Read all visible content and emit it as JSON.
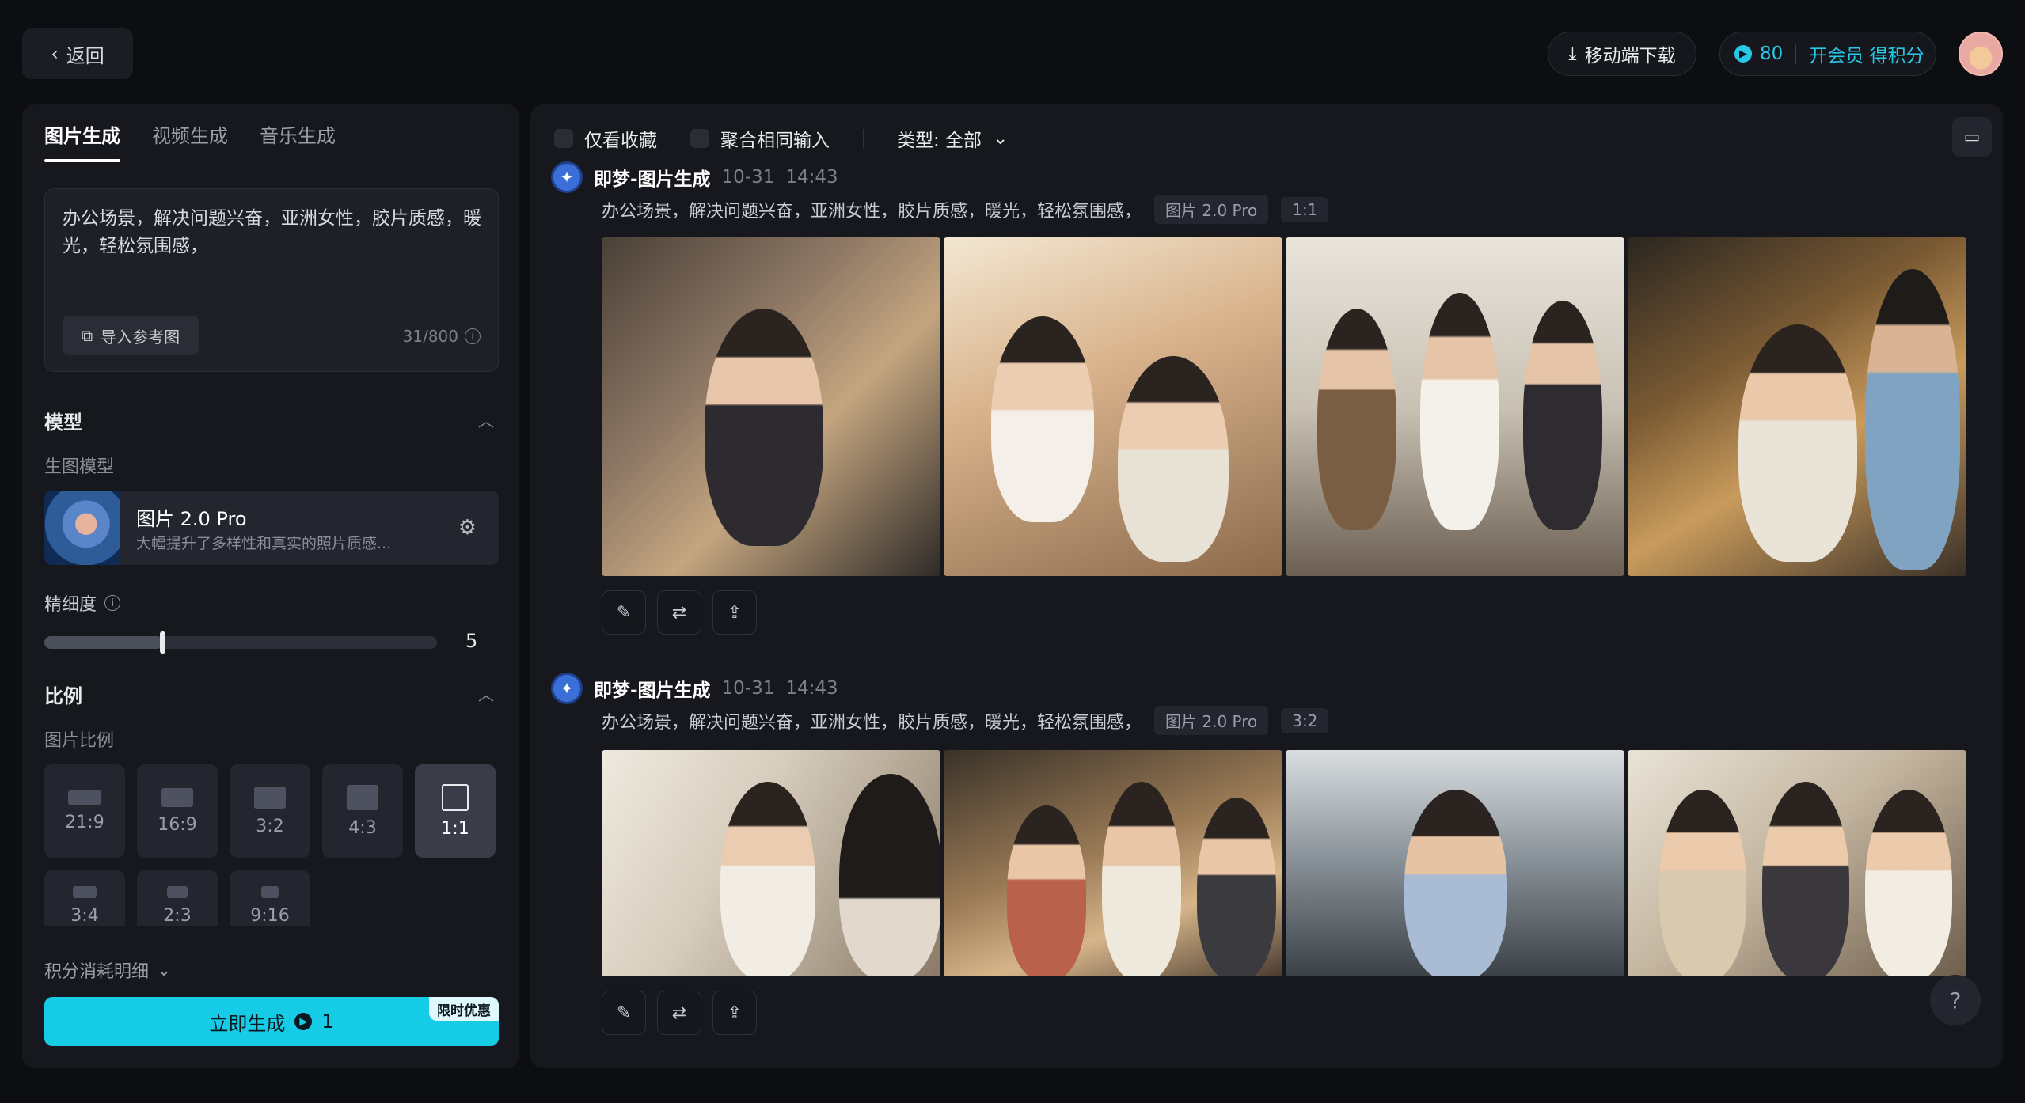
{
  "header": {
    "back_label": "返回",
    "mobile_download": "移动端下载",
    "points": "80",
    "vip_label": "开会员 得积分"
  },
  "left": {
    "tabs": [
      {
        "label": "图片生成",
        "active": true
      },
      {
        "label": "视频生成",
        "active": false
      },
      {
        "label": "音乐生成",
        "active": false
      }
    ],
    "prompt_text": "办公场景，解决问题兴奋，亚洲女性，胶片质感，暖光，轻松氛围感，",
    "import_label": "导入参考图",
    "char_count": "31/800",
    "model_section": "模型",
    "model_sub": "生图模型",
    "model_name": "图片 2.0 Pro",
    "model_desc": "大幅提升了多样性和真实的照片质感...",
    "detail_label": "精细度",
    "detail_value": "5",
    "detail_fraction": 0.3,
    "ratio_section": "比例",
    "ratio_sub": "图片比例",
    "ratios": [
      "21:9",
      "16:9",
      "3:2",
      "4:3",
      "1:1"
    ],
    "ratios_row2": [
      "3:4",
      "2:3",
      "9:16"
    ],
    "points_detail": "积分消耗明细",
    "generate_label": "立即生成",
    "generate_cost": "1",
    "promo_badge": "限时优惠"
  },
  "right": {
    "filter_favorites": "仅看收藏",
    "filter_merge": "聚合相同输入",
    "filter_type": "类型: 全部",
    "entries": [
      {
        "title": "即梦-图片生成",
        "date": "10-31",
        "time": "14:43",
        "prompt": "办公场景，解决问题兴奋，亚洲女性，胶片质感，暖光，轻松氛围感，",
        "model_tag": "图片 2.0 Pro",
        "ratio_tag": "1:1"
      },
      {
        "title": "即梦-图片生成",
        "date": "10-31",
        "time": "14:43",
        "prompt": "办公场景，解决问题兴奋，亚洲女性，胶片质感，暖光，轻松氛围感，",
        "model_tag": "图片 2.0 Pro",
        "ratio_tag": "3:2"
      }
    ],
    "help_label": "?"
  },
  "colors": {
    "accent": "#16cbe6",
    "background": "#0d0e12",
    "panel": "#16181e"
  }
}
